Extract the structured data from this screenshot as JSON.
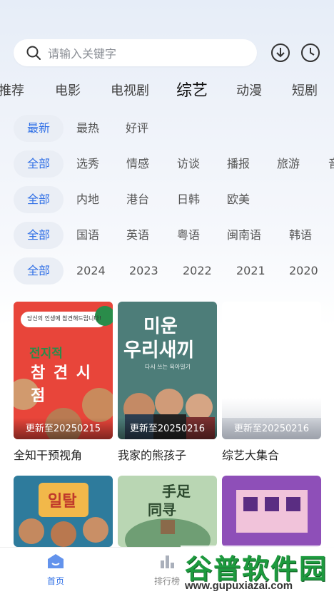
{
  "search": {
    "placeholder": "请输入关键字"
  },
  "categories": [
    "推荐",
    "电影",
    "电视剧",
    "综艺",
    "动漫",
    "短剧"
  ],
  "active_category": "综艺",
  "filters": {
    "sort": [
      "最新",
      "最热",
      "好评"
    ],
    "type": [
      "全部",
      "选秀",
      "情感",
      "访谈",
      "播报",
      "旅游",
      "音"
    ],
    "region": [
      "全部",
      "内地",
      "港台",
      "日韩",
      "欧美"
    ],
    "language": [
      "全部",
      "国语",
      "英语",
      "粤语",
      "闽南语",
      "韩语"
    ],
    "year": [
      "全部",
      "2024",
      "2023",
      "2022",
      "2021",
      "2020"
    ]
  },
  "cards": [
    {
      "title": "全知干预视角",
      "update": "更新至20250215",
      "poster_text": [
        "당신의 인생에 참견해드립니다!",
        "전지적",
        "참 견 시 점"
      ]
    },
    {
      "title": "我家的熊孩子",
      "update": "更新至20250216",
      "poster_text": [
        "미운",
        "우리새끼",
        "다시 쓰는 육아일기"
      ]
    },
    {
      "title": "综艺大集合",
      "update": "更新至20250216",
      "poster_text": []
    },
    {
      "title": "",
      "update": "",
      "poster_text": [
        "일탈"
      ]
    },
    {
      "title": "",
      "update": "",
      "poster_text": [
        "手足",
        "同寻"
      ]
    },
    {
      "title": "",
      "update": "",
      "poster_text": []
    }
  ],
  "bottom_nav": [
    {
      "label": "首页",
      "active": true
    },
    {
      "label": "排行榜",
      "active": false
    }
  ],
  "watermark": {
    "main": "谷普软件园",
    "url": "www.gupuxiazai.com"
  },
  "colors": {
    "accent": "#2f6fe6",
    "chip_bg": "#eaeef5"
  }
}
